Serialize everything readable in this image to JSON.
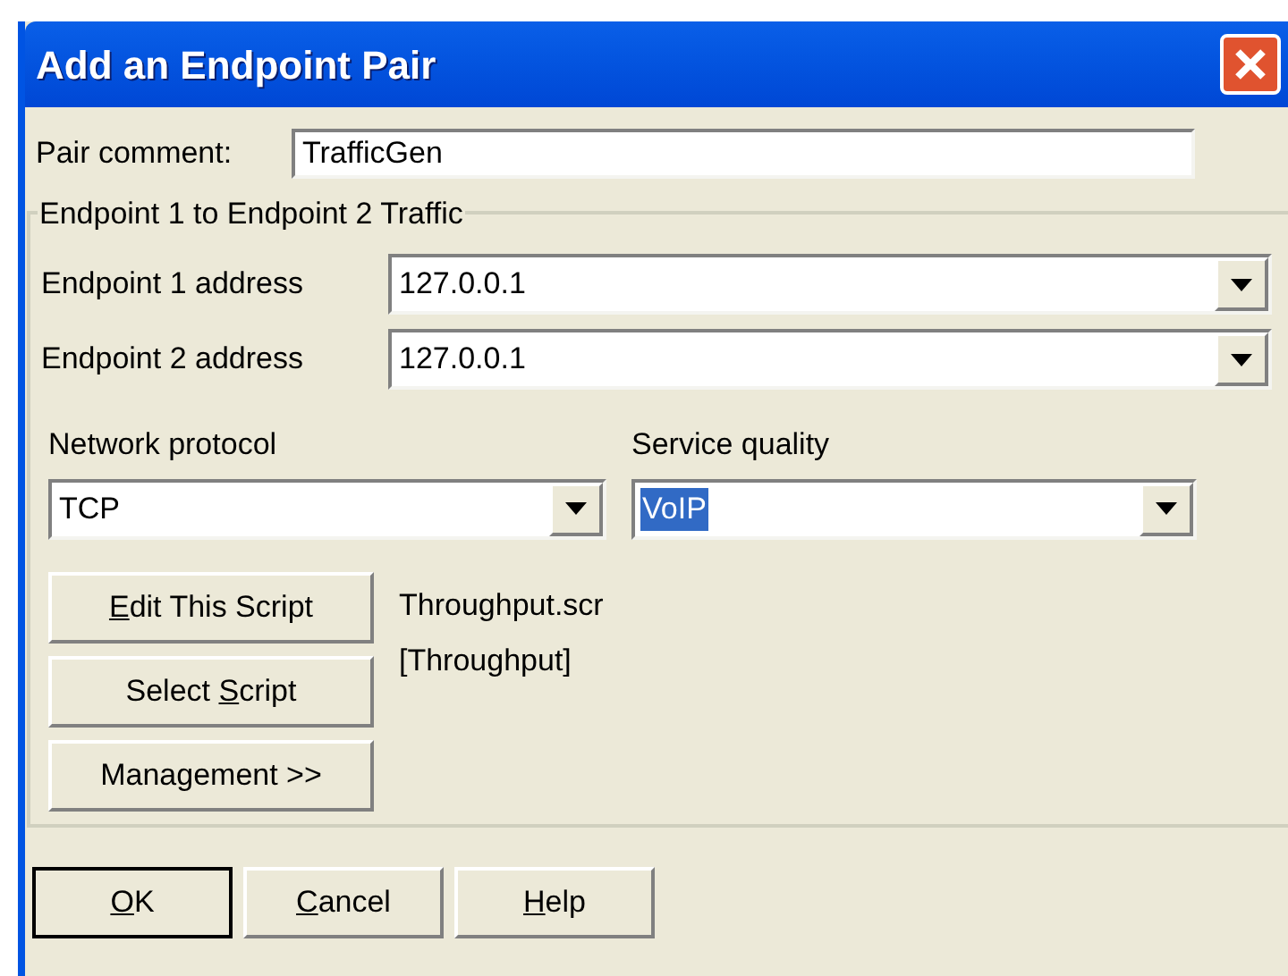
{
  "window": {
    "title": "Add an Endpoint Pair"
  },
  "pair_comment": {
    "label": "Pair comment:",
    "value": "TrafficGen"
  },
  "group": {
    "title": "Endpoint 1 to Endpoint 2 Traffic",
    "endpoints": [
      {
        "label": "Endpoint 1 address",
        "value": "127.0.0.1"
      },
      {
        "label": "Endpoint 2 address",
        "value": "127.0.0.1"
      }
    ],
    "selects": [
      {
        "label": "Network protocol",
        "value": "TCP",
        "selected": false
      },
      {
        "label": "Service quality",
        "value": "VoIP",
        "selected": true
      }
    ],
    "script_buttons": [
      {
        "key": "E",
        "after": "dit This Script"
      },
      {
        "before": "Select ",
        "key": "S",
        "after": "cript"
      },
      {
        "before": "Management >>"
      }
    ],
    "script_info": [
      "Throughput.scr",
      "[Throughput]"
    ]
  },
  "buttons": [
    {
      "key": "O",
      "after": "K",
      "default": true
    },
    {
      "key": "C",
      "after": "ancel",
      "default": false
    },
    {
      "key": "H",
      "after": "elp",
      "default": false
    }
  ]
}
